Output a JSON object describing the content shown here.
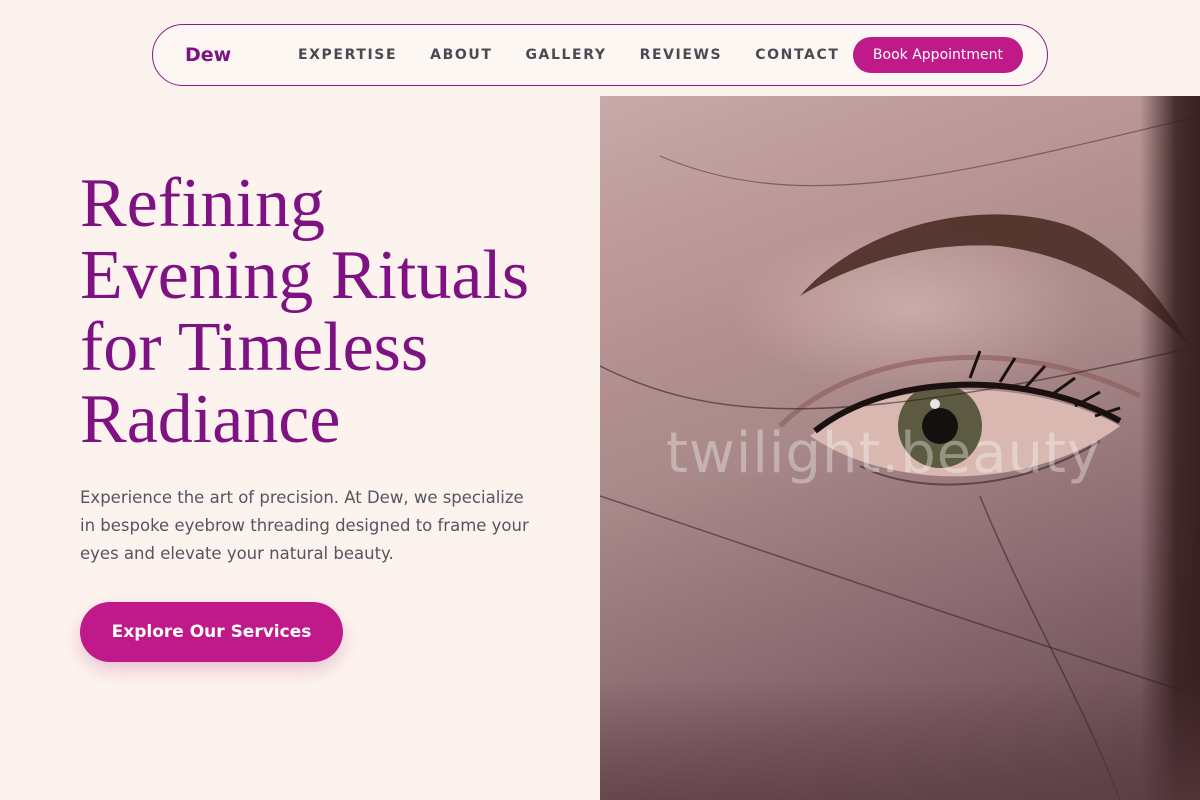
{
  "nav": {
    "brand": "Dew",
    "links": [
      "EXPERTISE",
      "ABOUT",
      "GALLERY",
      "REVIEWS",
      "CONTACT"
    ],
    "cta_label": "Book Appointment"
  },
  "hero": {
    "headline": "Refining Evening Rituals for Timeless Radiance",
    "subtext": "Experience the art of precision. At Dew, we specialize in bespoke eyebrow threading designed to frame your eyes and elevate your natural beauty.",
    "cta_label": "Explore Our Services",
    "image_watermark": "twilight.beauty"
  },
  "colors": {
    "accent": "#c0198a",
    "brand": "#7e1283",
    "background": "#fdf3ee"
  }
}
